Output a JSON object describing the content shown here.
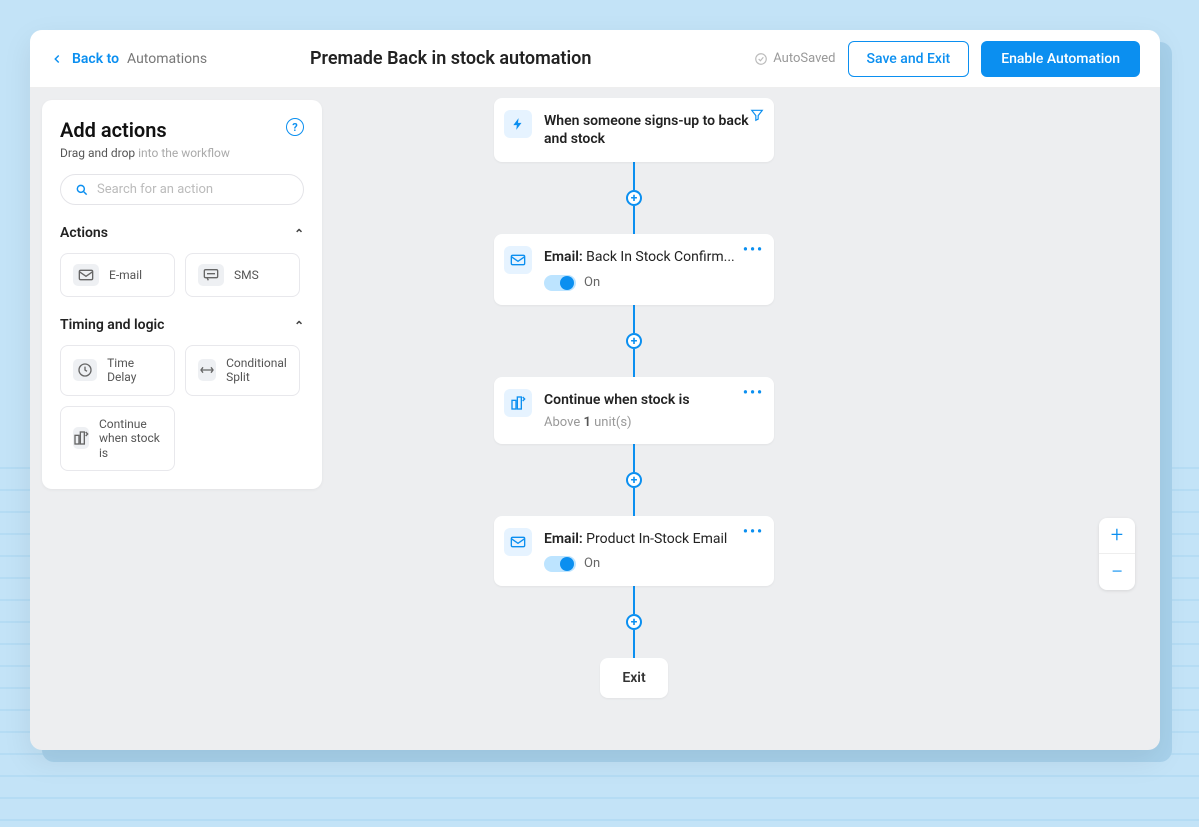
{
  "header": {
    "back_prefix": "Back to",
    "back_suffix": "Automations",
    "title": "Premade Back in stock automation",
    "autosaved": "AutoSaved",
    "save_exit": "Save and Exit",
    "enable": "Enable Automation"
  },
  "sidebar": {
    "title": "Add actions",
    "hint_bold": "Drag and drop",
    "hint_light": "into the workflow",
    "search_placeholder": "Search for an action",
    "section_actions": "Actions",
    "section_timing": "Timing and logic",
    "pill_email": "E-mail",
    "pill_sms": "SMS",
    "pill_delay": "Time Delay",
    "pill_split": "Conditional Split",
    "pill_stock": "Continue when stock is"
  },
  "flow": {
    "trigger": "When someone signs-up to back and stock",
    "email1_label": "Email:",
    "email1_value": "Back In Stock Confirm...",
    "on": "On",
    "stock_title": "Continue when stock is",
    "stock_above": "Above",
    "stock_num": "1",
    "stock_units": "unit(s)",
    "email2_label": "Email:",
    "email2_value": "Product In-Stock Email",
    "exit": "Exit"
  },
  "zoom": {
    "plus": "+",
    "minus": "−"
  }
}
